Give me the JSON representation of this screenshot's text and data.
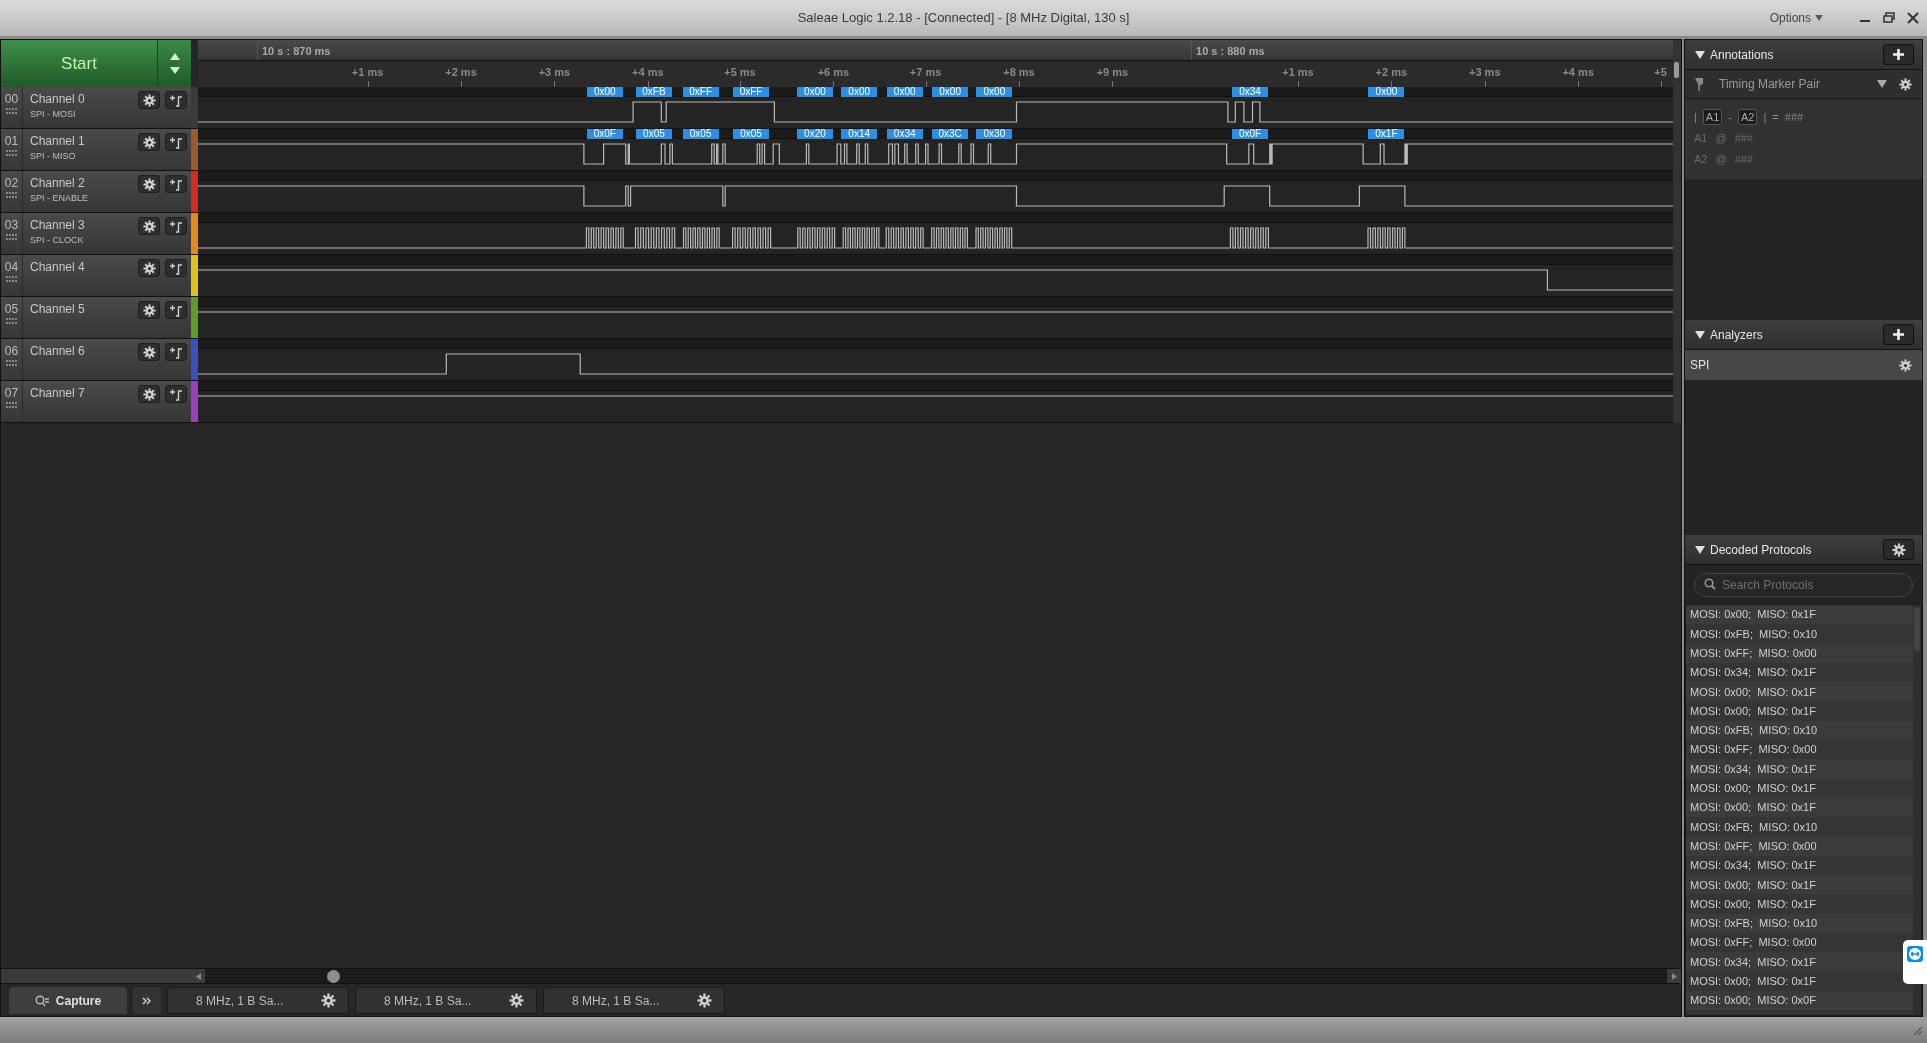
{
  "window": {
    "title": "Saleae Logic 1.2.18 - [Connected] - [8 MHz Digital, 130 s]",
    "menu": "Options"
  },
  "start_button": {
    "label": "Start"
  },
  "timeline": {
    "markers": [
      "10 s : 870 ms",
      "10 s : 880 ms"
    ],
    "ticks": [
      "+1 ms",
      "+2 ms",
      "+3 ms",
      "+4 ms",
      "+5 ms",
      "+6 ms",
      "+7 ms",
      "+8 ms",
      "+9 ms",
      "+1 ms",
      "+2 ms",
      "+3 ms",
      "+4 ms",
      "+5"
    ]
  },
  "channels": [
    {
      "number": "00",
      "name": "Channel 0",
      "label": "SPI - MOSI",
      "color": "#3a3a3a",
      "decoded": [
        "0x00",
        "0xFB",
        "0xFF",
        "0xFF",
        "0x00",
        "0x00",
        "0x00",
        "0x00",
        "0x00",
        "0x34",
        "0x00"
      ]
    },
    {
      "number": "01",
      "name": "Channel 1",
      "label": "SPI - MISO",
      "color": "#9a5a2c",
      "decoded": [
        "0x0F",
        "0x05",
        "0x05",
        "0x05",
        "0x20",
        "0x14",
        "0x34",
        "0x3C",
        "0x30",
        "0x0F",
        "0x1F"
      ]
    },
    {
      "number": "02",
      "name": "Channel 2",
      "label": "SPI - ENABLE",
      "color": "#d42a24"
    },
    {
      "number": "03",
      "name": "Channel 3",
      "label": "SPI - CLOCK",
      "color": "#e58a12"
    },
    {
      "number": "04",
      "name": "Channel 4",
      "color": "#e2c21a"
    },
    {
      "number": "05",
      "name": "Channel 5",
      "color": "#5c9e2c"
    },
    {
      "number": "06",
      "name": "Channel 6",
      "color": "#3c4ec2"
    },
    {
      "number": "07",
      "name": "Channel 7",
      "color": "#9a3ec0"
    }
  ],
  "annotations": {
    "title": "Annotations",
    "marker_type": "Timing Marker Pair",
    "formula": [
      {
        "kind": "text",
        "text": "|"
      },
      {
        "kind": "key",
        "text": "A1"
      },
      {
        "kind": "text",
        "text": "-"
      },
      {
        "kind": "key",
        "text": "A2"
      },
      {
        "kind": "text",
        "text": "|"
      },
      {
        "kind": "text",
        "text": "="
      },
      {
        "kind": "value",
        "text": "###"
      }
    ],
    "markers": [
      {
        "name": "A1",
        "at": "@",
        "value": "###"
      },
      {
        "name": "A2",
        "at": "@",
        "value": "###"
      }
    ]
  },
  "analyzers": {
    "title": "Analyzers",
    "items": [
      {
        "name": "SPI",
        "selected": true
      }
    ]
  },
  "decoded_protocols": {
    "title": "Decoded Protocols",
    "search": {
      "placeholder": "Search Protocols"
    },
    "rows": [
      "MOSI: 0x00;  MISO: 0x1F",
      "MOSI: 0xFB;  MISO: 0x10",
      "MOSI: 0xFF;  MISO: 0x00",
      "MOSI: 0x34;  MISO: 0x1F",
      "MOSI: 0x00;  MISO: 0x1F",
      "MOSI: 0x00;  MISO: 0x1F",
      "MOSI: 0xFB;  MISO: 0x10",
      "MOSI: 0xFF;  MISO: 0x00",
      "MOSI: 0x34;  MISO: 0x1F",
      "MOSI: 0x00;  MISO: 0x1F",
      "MOSI: 0x00;  MISO: 0x1F",
      "MOSI: 0xFB;  MISO: 0x10",
      "MOSI: 0xFF;  MISO: 0x00",
      "MOSI: 0x34;  MISO: 0x1F",
      "MOSI: 0x00;  MISO: 0x1F",
      "MOSI: 0x00;  MISO: 0x1F",
      "MOSI: 0xFB;  MISO: 0x10",
      "MOSI: 0xFF;  MISO: 0x00",
      "MOSI: 0x34;  MISO: 0x1F",
      "MOSI: 0x00;  MISO: 0x1F",
      "MOSI: 0x00;  MISO: 0x0F"
    ]
  },
  "bottom_tabs": {
    "capture": "Capture",
    "sessions": [
      "8 MHz, 1 B Sa...",
      "8 MHz, 1 B Sa...",
      "8 MHz, 1 B Sa..."
    ]
  }
}
